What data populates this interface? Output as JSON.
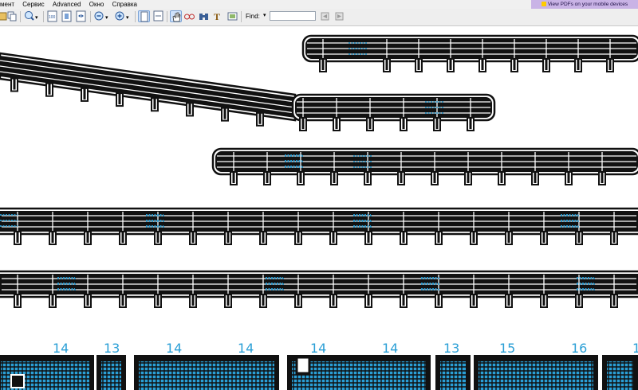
{
  "menu": {
    "items": [
      "мент",
      "Сервис",
      "Advanced",
      "Окно",
      "Справка"
    ]
  },
  "promo": {
    "label": "View PDFs on your mobile devices"
  },
  "toolbar": {
    "find_label": "Find:",
    "find_value": ""
  },
  "sheet": {
    "part_numbers": [
      "14",
      "13",
      "14",
      "14",
      "14",
      "14",
      "13",
      "15",
      "16",
      "1"
    ]
  },
  "colors": {
    "part_fill": "#111111",
    "grid_accent": "#2a9fd6",
    "toolbar_bg": "#eeeeee"
  }
}
